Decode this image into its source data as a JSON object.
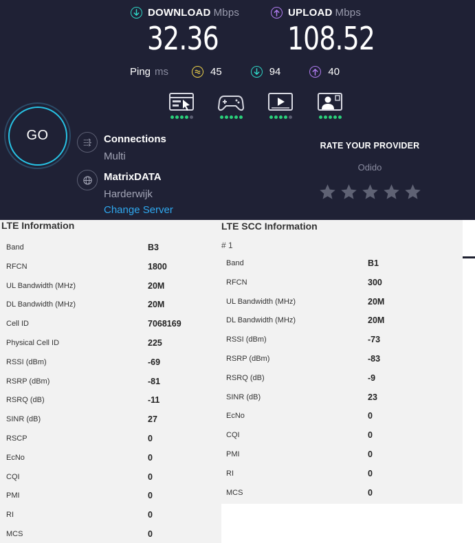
{
  "speedtest": {
    "download": {
      "label": "DOWNLOAD",
      "unit": "Mbps",
      "value": "32.36",
      "color": "#2fd6c6"
    },
    "upload": {
      "label": "UPLOAD",
      "unit": "Mbps",
      "value": "108.52",
      "color": "#b07cf0"
    },
    "ping": {
      "label": "Ping",
      "unit": "ms",
      "idle": {
        "value": "45",
        "icon": "idle-icon",
        "color": "#f0d44a"
      },
      "download": {
        "value": "94",
        "icon": "download-arrow-icon",
        "color": "#2fd6c6"
      },
      "upload": {
        "value": "40",
        "icon": "upload-arrow-icon",
        "color": "#b07cf0"
      }
    },
    "apps": [
      {
        "icon": "web-browsing-icon",
        "dots": 4
      },
      {
        "icon": "gaming-icon",
        "dots": 5
      },
      {
        "icon": "video-streaming-icon",
        "dots": 4
      },
      {
        "icon": "video-call-icon",
        "dots": 5
      }
    ],
    "go_label": "GO",
    "connections": {
      "title": "Connections",
      "value": "Multi",
      "icon": "connections-icon"
    },
    "server": {
      "title": "MatrixDATA",
      "location": "Harderwijk",
      "change_label": "Change Server",
      "icon": "globe-icon"
    },
    "rate": {
      "title": "RATE YOUR PROVIDER",
      "provider": "Odido",
      "stars_total": 5,
      "stars_filled": 0
    },
    "colors": {
      "background": "#1f2135",
      "accent_link": "#2fa9f0",
      "go_ring": "#27c4e6",
      "dot_on": "#2ad07a",
      "dot_off": "#5b5e72"
    }
  },
  "lte": {
    "title": "LTE Information",
    "rows": [
      {
        "label": "Band",
        "value": "B3"
      },
      {
        "label": "RFCN",
        "value": "1800"
      },
      {
        "label": "UL Bandwidth (MHz)",
        "value": "20M"
      },
      {
        "label": "DL Bandwidth (MHz)",
        "value": "20M"
      },
      {
        "label": "Cell ID",
        "value": "7068169"
      },
      {
        "label": "Physical Cell ID",
        "value": "225"
      },
      {
        "label": "RSSI (dBm)",
        "value": "-69"
      },
      {
        "label": "RSRP (dBm)",
        "value": "-81"
      },
      {
        "label": "RSRQ (dB)",
        "value": "-11"
      },
      {
        "label": "SINR (dB)",
        "value": "27"
      },
      {
        "label": "RSCP",
        "value": "0"
      },
      {
        "label": "EcNo",
        "value": "0"
      },
      {
        "label": "CQI",
        "value": "0"
      },
      {
        "label": "PMI",
        "value": "0"
      },
      {
        "label": "RI",
        "value": "0"
      },
      {
        "label": "MCS",
        "value": "0"
      }
    ]
  },
  "lte_scc": {
    "title": "LTE SCC Information",
    "index_label": "# 1",
    "rows": [
      {
        "label": "Band",
        "value": "B1"
      },
      {
        "label": "RFCN",
        "value": "300"
      },
      {
        "label": "UL Bandwidth (MHz)",
        "value": "20M"
      },
      {
        "label": "DL Bandwidth (MHz)",
        "value": "20M"
      },
      {
        "label": "RSSI (dBm)",
        "value": "-73"
      },
      {
        "label": "RSRP (dBm)",
        "value": "-83"
      },
      {
        "label": "RSRQ (dB)",
        "value": "-9"
      },
      {
        "label": "SINR (dB)",
        "value": "23"
      },
      {
        "label": "EcNo",
        "value": "0"
      },
      {
        "label": "CQI",
        "value": "0"
      },
      {
        "label": "PMI",
        "value": "0"
      },
      {
        "label": "RI",
        "value": "0"
      },
      {
        "label": "MCS",
        "value": "0"
      }
    ]
  }
}
